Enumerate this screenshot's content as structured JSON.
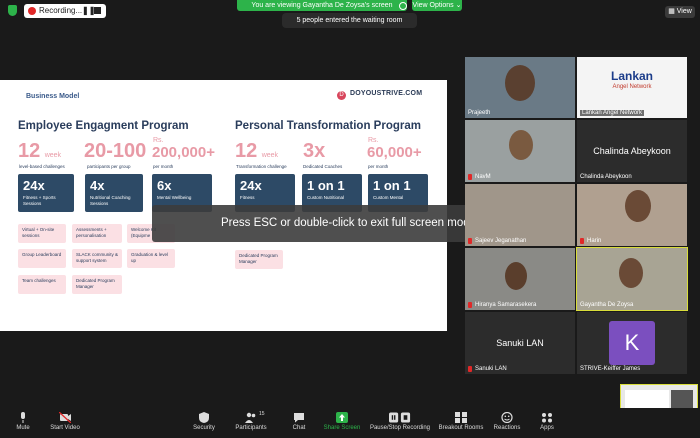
{
  "top": {
    "recording_label": "Recording...",
    "viewing_banner": "You are viewing Gayantha De Zoysa's screen",
    "view_options": "View Options",
    "waiting_notice": "5 people entered the waiting room",
    "view_button": "View"
  },
  "slide": {
    "section_title": "Business Model",
    "brand": "DOYOUSTRIVE.COM",
    "left": {
      "title": "Employee Engagment Program",
      "stats": [
        {
          "value": "12",
          "unit": "week",
          "label": "level-based challenges"
        },
        {
          "value": "20-100",
          "unit": "",
          "label": "participants per group"
        },
        {
          "value": "200,000+",
          "unit": "Rs.",
          "label": "per month"
        }
      ],
      "boxes": [
        {
          "big": "24x",
          "sub": "Fitness + Sports Sessions"
        },
        {
          "big": "4x",
          "sub": "Nutritional Coaching Sessions"
        },
        {
          "big": "6x",
          "sub": "Mental Wellbeing"
        }
      ],
      "col1": [
        "Virtual + On-site sessions",
        "Group Leaderboard",
        "Team challenges"
      ],
      "col2": [
        "Assessments + personalisation",
        "SLACK community & support system",
        "Dedicated Program Manager"
      ],
      "col3": [
        "Welcome Kit (Equipme",
        "Graduation & level up"
      ]
    },
    "right": {
      "title": "Personal Transformation Program",
      "stats": [
        {
          "value": "12",
          "unit": "week",
          "label": "Transformation challenge"
        },
        {
          "value": "3x",
          "unit": "",
          "label": "Dedicated Coaches"
        },
        {
          "value": "60,000+",
          "unit": "Rs.",
          "label": "per month"
        }
      ],
      "boxes": [
        {
          "big": "24x",
          "sub": "Fitness"
        },
        {
          "big": "1 on 1",
          "sub": "Custom Nutritional"
        },
        {
          "big": "1 on 1",
          "sub": "Custom Mental"
        }
      ],
      "col1": [
        "Dedicated Program Manager"
      ]
    }
  },
  "overlay": {
    "esc_message": "Press ESC or double-click to exit full screen mode"
  },
  "participants": {
    "prajeeth": "Prajeeth",
    "lankan_angel": "Lankan Angel Network",
    "lankan_logo_1": "Lankan",
    "lankan_logo_2": "Angel Network",
    "navm": "NavM",
    "chalinda_big": "Chalinda Abeykoon",
    "chalinda": "Chalinda Abeykoon",
    "sajeev": "Sajeev Jeganathan",
    "harin": "Harin",
    "hiranya": "Hiranya Samarasekera",
    "gayantha": "Gayantha De Zoysa",
    "sanuki_big": "Sanuki LAN",
    "sanuki": "Sanuki LAN",
    "keiffer_initial": "K",
    "keiffer": "STRIVE-Keiffer James",
    "seg_label": "SLT"
  },
  "toolbar": {
    "mute": "Mute",
    "start_video": "Start Video",
    "security": "Security",
    "participants": "Participants",
    "participants_count": "15",
    "chat": "Chat",
    "share_screen": "Share Screen",
    "pause_recording": "Pause/Stop Recording",
    "breakout": "Breakout Rooms",
    "reactions": "Reactions",
    "apps": "Apps"
  },
  "colors": {
    "accent_green": "#2db34a",
    "record_red": "#e02828",
    "slide_pink": "#e89aa6",
    "slide_navy": "#2d4a66"
  }
}
